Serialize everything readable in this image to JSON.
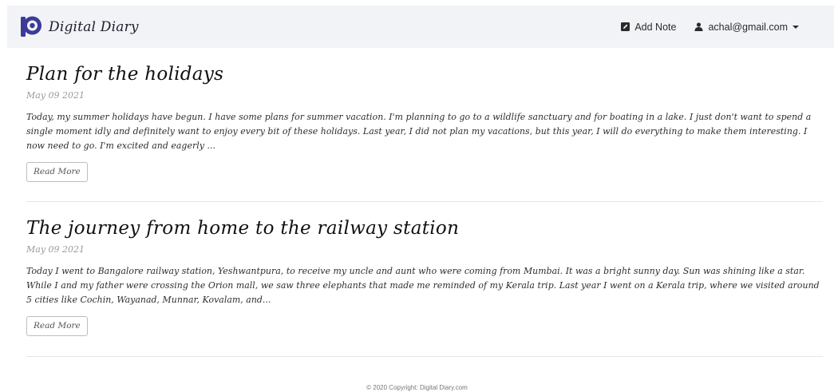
{
  "header": {
    "brand_name": "Digital Diary",
    "add_note_label": "Add Note",
    "user_email": "achal@gmail.com"
  },
  "posts": [
    {
      "title": "Plan for the holidays",
      "date": "May 09 2021",
      "excerpt": "Today, my summer holidays have begun. I have some plans for summer vacation. I'm planning to go to a wildlife sanctuary and for boating in a lake. I just don't want to spend a single moment idly and definitely want to enjoy every bit of these holidays. Last year, I did not plan my vacations, but this year, I will do everything to make them interesting. I now need to go. I'm excited and eagerly ...",
      "read_more_label": "Read More"
    },
    {
      "title": "The journey from home to the railway station",
      "date": "May 09 2021",
      "excerpt": "Today I went to Bangalore railway station, Yeshwantpura, to receive my uncle and aunt who were coming from Mumbai. It was a bright sunny day. Sun was shining like a star. While I and my father were crossing the Orion mall, we saw three elephants that made me reminded of my Kerala trip. Last year I went on a Kerala trip, where we visited around 5 cities like Cochin, Wayanad, Munnar, Kovalam, and...",
      "read_more_label": "Read More"
    }
  ],
  "footer": {
    "copyright": "© 2020 Copyright: Digital Diary.com"
  },
  "colors": {
    "brand": "#3b3b98",
    "navbar_bg": "#f1f3f7",
    "muted_date": "#9a9a9a"
  },
  "icons": {
    "brand_logo": "brand-logo-icon",
    "add_note": "pencil-square-icon",
    "user": "user-icon",
    "dropdown": "caret-down-icon"
  }
}
